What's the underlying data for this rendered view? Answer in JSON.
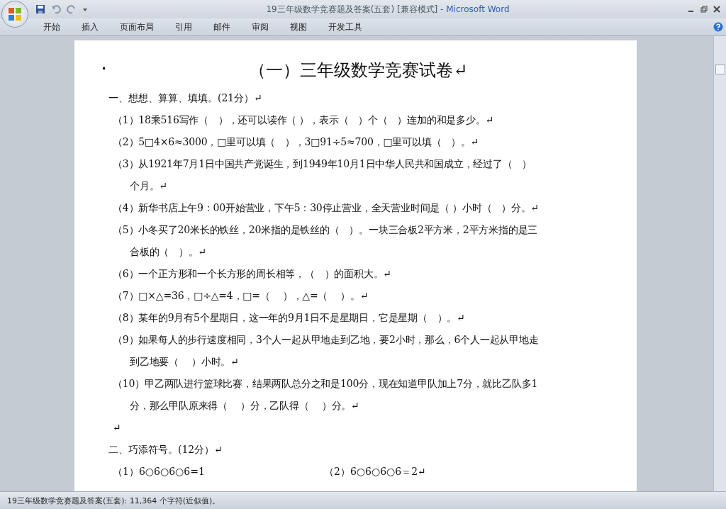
{
  "window": {
    "title": "19三年级数学竞赛题及答案(五套) [兼容模式]",
    "app_name": "- Microsoft Word"
  },
  "ribbon_tabs": [
    {
      "label": "开始",
      "selected": false
    },
    {
      "label": "插入",
      "selected": false
    },
    {
      "label": "页面布局",
      "selected": false
    },
    {
      "label": "引用",
      "selected": false
    },
    {
      "label": "邮件",
      "selected": false
    },
    {
      "label": "审阅",
      "selected": false
    },
    {
      "label": "视图",
      "selected": false
    },
    {
      "label": "开发工具",
      "selected": false
    }
  ],
  "document": {
    "title": "（一）三年级数学竞赛试卷↵",
    "sections": [
      {
        "heading": "一、想想、算算、填填。(21分）↵",
        "items": [
          {
            "lines": [
              "（1）18乘516写作（　），还可以读作（ ），表示（　）个（　）连加的和是多少。↵"
            ]
          },
          {
            "lines": [
              "（2）5□4×6≈3000，□里可以填（　），3□91÷5≈700，□里可以填（　）。↵"
            ]
          },
          {
            "lines": [
              "（3）从1921年7月1日中国共产党诞生，到1949年10月1日中华人民共和国成立，经过了（　）",
              "个月。↵"
            ]
          },
          {
            "lines": [
              "（4）新华书店上午9：00开始营业，下午5：30停止营业，全天营业时间是（ ）小时（　）分。↵"
            ]
          },
          {
            "lines": [
              "（5）小冬买了20米长的铁丝，20米指的是铁丝的（　）。一块三合板2平方米，2平方米指的是三",
              "合板的（　）。↵"
            ]
          },
          {
            "lines": [
              "（6）一个正方形和一个长方形的周长相等，（　）的面积大。↵"
            ]
          },
          {
            "lines": [
              "（7）□×△=36，□÷△=4，□=（　 ），△=（　 ）。↵"
            ]
          },
          {
            "lines": [
              "（8）某年的9月有5个星期日，这一年的9月1日不是星期日，它是星期（　）。↵"
            ]
          },
          {
            "lines": [
              "（9）如果每人的步行速度相同，3个人一起从甲地走到乙地，要2小时，那么，6个人一起从甲地走",
              "到乙地要（　 ）小时。↵"
            ]
          },
          {
            "lines": [
              "（10）甲乙两队进行篮球比赛，结果两队总分之和是100分，现在知道甲队加上7分，就比乙队多1",
              "分，那么甲队原来得（　 ）分，乙队得（　 ）分。↵"
            ]
          },
          {
            "lines": [
              "↵"
            ]
          }
        ]
      },
      {
        "heading": "二、巧添符号。(12分）↵",
        "columns": [
          "（1）6○6○6○6=1",
          "（2）6○6○6○6＝2↵"
        ]
      }
    ]
  },
  "status_bar": {
    "text": "19三年级数学竞赛题及答案(五套): 11,364 个字符(近似值)。"
  }
}
